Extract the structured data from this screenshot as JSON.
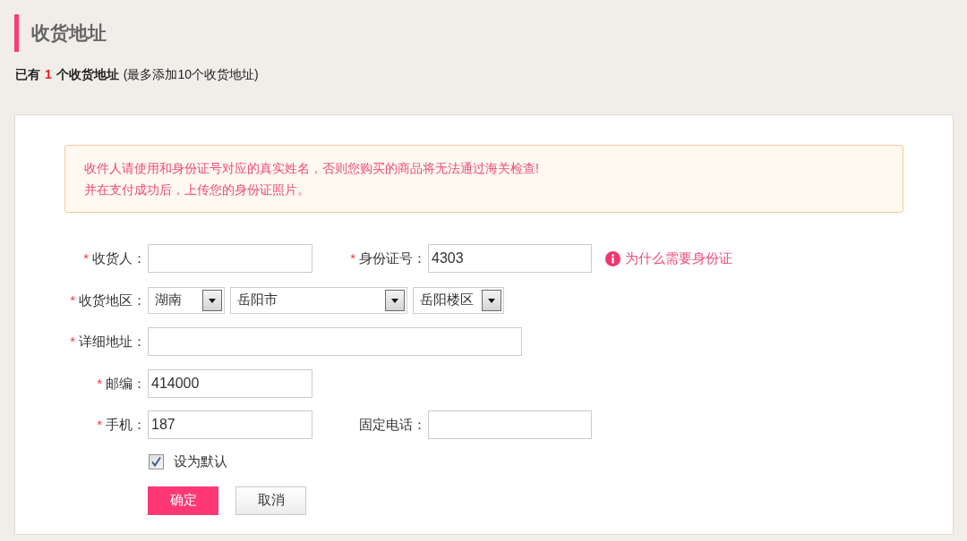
{
  "page": {
    "title": "收货地址"
  },
  "summary": {
    "prefix": "已有",
    "count": "1",
    "suffix": "个收货地址",
    "note": "(最多添加10个收货地址)"
  },
  "notice": {
    "lines": [
      "收件人请使用和身份证号对应的真实姓名，否则您购买的商品将无法通过海关检查!",
      "并在支付成功后，上传您的身份证照片。"
    ]
  },
  "form": {
    "rows": [
      {
        "fields": [
          {
            "kind": "text",
            "mark": "*",
            "label": "收货人："
          },
          {
            "kind": "text",
            "mark": "*",
            "label": "身份证号：",
            "value": "4303"
          },
          {
            "kind": "help_link",
            "text": "为什么需要身份证"
          }
        ]
      },
      {
        "fields": [
          {
            "kind": "region",
            "mark": "*",
            "label": "收货地区：",
            "selects": [
              {
                "kind": "province",
                "value": "湖南"
              },
              {
                "kind": "city",
                "value": "岳阳市"
              },
              {
                "kind": "district",
                "value": "岳阳楼区"
              }
            ]
          }
        ]
      },
      {
        "fields": [
          {
            "kind": "long_text",
            "mark": "*",
            "label": "详细地址："
          }
        ]
      },
      {
        "fields": [
          {
            "kind": "text",
            "mark": "*",
            "label": "邮编：",
            "value": "414000"
          }
        ]
      },
      {
        "fields": [
          {
            "kind": "text",
            "mark": "*",
            "label": "手机：",
            "value": "187"
          },
          {
            "kind": "text",
            "label": "固定电话："
          }
        ]
      }
    ],
    "default_address": {
      "label": "设为默认",
      "checked": true
    },
    "buttons": [
      {
        "kind": "confirm",
        "label": "确定"
      },
      {
        "kind": "cancel",
        "label": "取消"
      }
    ]
  }
}
